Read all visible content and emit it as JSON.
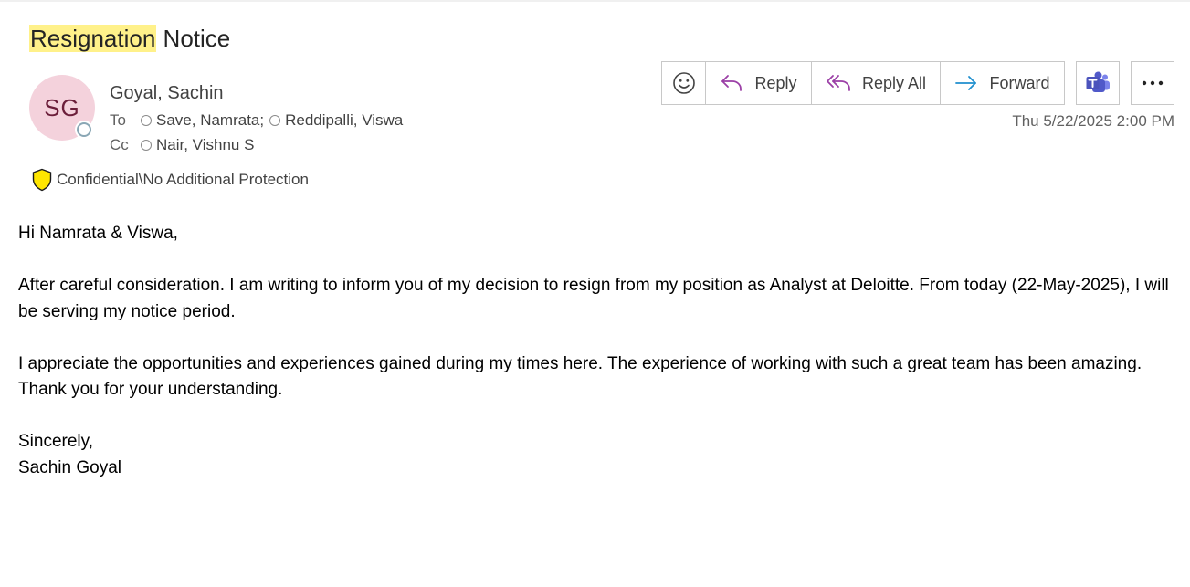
{
  "email": {
    "subject_highlight": "Resignation",
    "subject_rest": " Notice",
    "avatar_initials": "SG",
    "sender": "Goyal, Sachin",
    "to_label": "To",
    "to": [
      "Save, Namrata;",
      "Reddipalli, Viswa"
    ],
    "cc_label": "Cc",
    "cc": [
      "Nair, Vishnu S"
    ],
    "sensitivity": "Confidential\\No Additional Protection",
    "datetime": "Thu 5/22/2025 2:00 PM"
  },
  "toolbar": {
    "reply_label": "Reply",
    "reply_all_label": "Reply All",
    "forward_label": "Forward"
  },
  "icons": {
    "emoji": "emoji-icon",
    "reply": "reply-icon",
    "reply_all": "reply-all-icon",
    "forward": "forward-icon",
    "teams": "teams-icon",
    "more": "more-icon",
    "sensitivity": "shield-icon"
  },
  "colors": {
    "highlight": "#fff18a",
    "avatar_bg": "#f4d2dc",
    "avatar_text": "#6b1e3a",
    "reply_icon": "#9b3fa6",
    "forward_icon": "#1f8fce",
    "teams": "#4b53bc",
    "shield": "#ffe600"
  },
  "body": {
    "greeting": "Hi Namrata & Viswa,",
    "para1": "After careful consideration. I am writing to inform you of my decision to resign from my position as Analyst at Deloitte. From today (22-May-2025), I will be serving my notice period.",
    "para2_line1": "I appreciate the opportunities and experiences gained during my times here. The experience of working with such a great team has been amazing.",
    "para2_line2": "Thank you for your understanding.",
    "closing": "Sincerely,",
    "signature": "Sachin Goyal"
  }
}
